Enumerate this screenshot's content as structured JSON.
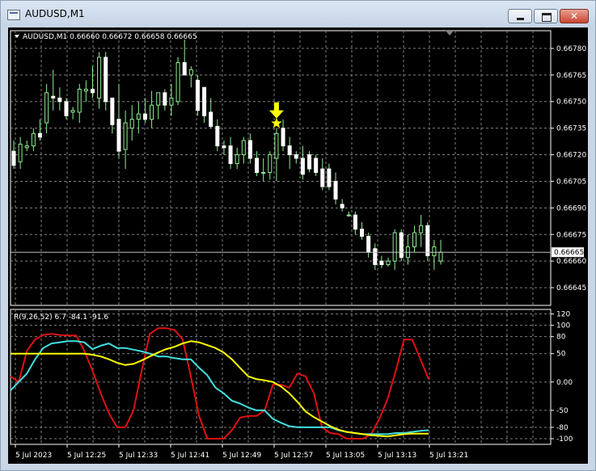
{
  "window": {
    "title": "AUDUSD,M1",
    "min_glyph": "",
    "max_glyph": "",
    "close_glyph": "✕"
  },
  "main_panel": {
    "info": "AUDUSD,M1  0.66660 0.66672 0.66658 0.66665",
    "current_price": "0.66665",
    "price_labels": [
      "0.66780",
      "0.66765",
      "0.66750",
      "0.66735",
      "0.66720",
      "0.66705",
      "0.66690",
      "0.66675",
      "0.66660",
      "0.66645"
    ]
  },
  "indicator_panel": {
    "info": "R(9,26,52) 6.7 -84.1 -91.6",
    "levels": [
      "120",
      "100",
      "80",
      "50",
      "0.00",
      "-50",
      "-80",
      "-100"
    ]
  },
  "time_labels": [
    "5 Jul 2023",
    "5 Jul 12:25",
    "5 Jul 12:33",
    "5 Jul 12:41",
    "5 Jul 12:49",
    "5 Jul 12:57",
    "5 Jul 13:05",
    "5 Jul 13:13",
    "5 Jul 13:21"
  ],
  "colors": {
    "background": "#000000",
    "grid": "#808080",
    "candle": "#90ee90",
    "arrow": "#ffff00",
    "line_fast": "#e01010",
    "line_mid": "#40e0e0",
    "line_slow": "#ffff00"
  },
  "chart_data": [
    {
      "type": "candlestick",
      "symbol": "AUDUSD",
      "timeframe": "M1",
      "ylim": [
        0.66635,
        0.6679
      ],
      "y_ticks": [
        0.6678,
        0.66765,
        0.6675,
        0.66735,
        0.6672,
        0.66705,
        0.6669,
        0.66675,
        0.6666,
        0.66645
      ],
      "current_price": 0.66665,
      "signal_marker": {
        "candle_index": 40,
        "type": "down-arrow-star"
      },
      "candles": [
        {
          "o": 0.66722,
          "h": 0.66728,
          "l": 0.66712,
          "c": 0.66714
        },
        {
          "o": 0.66716,
          "h": 0.6673,
          "l": 0.66712,
          "c": 0.66726
        },
        {
          "o": 0.66724,
          "h": 0.66728,
          "l": 0.66722,
          "c": 0.66725
        },
        {
          "o": 0.66725,
          "h": 0.66735,
          "l": 0.66722,
          "c": 0.66732
        },
        {
          "o": 0.66732,
          "h": 0.6674,
          "l": 0.66728,
          "c": 0.6673
        },
        {
          "o": 0.66738,
          "h": 0.6676,
          "l": 0.66732,
          "c": 0.66755
        },
        {
          "o": 0.66753,
          "h": 0.66768,
          "l": 0.66745,
          "c": 0.66752
        },
        {
          "o": 0.66752,
          "h": 0.66758,
          "l": 0.66745,
          "c": 0.6675
        },
        {
          "o": 0.6675,
          "h": 0.66752,
          "l": 0.6674,
          "c": 0.66742
        },
        {
          "o": 0.66744,
          "h": 0.66747,
          "l": 0.6674,
          "c": 0.66745
        },
        {
          "o": 0.66744,
          "h": 0.6676,
          "l": 0.66738,
          "c": 0.66757
        },
        {
          "o": 0.66756,
          "h": 0.66762,
          "l": 0.6675,
          "c": 0.66757
        },
        {
          "o": 0.66757,
          "h": 0.6677,
          "l": 0.66752,
          "c": 0.66755
        },
        {
          "o": 0.66752,
          "h": 0.66778,
          "l": 0.66746,
          "c": 0.66775
        },
        {
          "o": 0.66775,
          "h": 0.66778,
          "l": 0.66745,
          "c": 0.6675
        },
        {
          "o": 0.66752,
          "h": 0.66752,
          "l": 0.66732,
          "c": 0.66737
        },
        {
          "o": 0.6674,
          "h": 0.6676,
          "l": 0.66718,
          "c": 0.66722
        },
        {
          "o": 0.66723,
          "h": 0.66745,
          "l": 0.66712,
          "c": 0.66738
        },
        {
          "o": 0.66735,
          "h": 0.66748,
          "l": 0.66728,
          "c": 0.6674
        },
        {
          "o": 0.6674,
          "h": 0.6675,
          "l": 0.66732,
          "c": 0.66743
        },
        {
          "o": 0.66743,
          "h": 0.66752,
          "l": 0.66738,
          "c": 0.6674
        },
        {
          "o": 0.6674,
          "h": 0.66756,
          "l": 0.66735,
          "c": 0.66748
        },
        {
          "o": 0.66748,
          "h": 0.66755,
          "l": 0.6674,
          "c": 0.66755
        },
        {
          "o": 0.66755,
          "h": 0.66757,
          "l": 0.66745,
          "c": 0.66748
        },
        {
          "o": 0.66748,
          "h": 0.6676,
          "l": 0.66742,
          "c": 0.66752
        },
        {
          "o": 0.6675,
          "h": 0.66775,
          "l": 0.66748,
          "c": 0.66772
        },
        {
          "o": 0.66772,
          "h": 0.66785,
          "l": 0.66765,
          "c": 0.66765
        },
        {
          "o": 0.66765,
          "h": 0.6677,
          "l": 0.66758,
          "c": 0.66768
        },
        {
          "o": 0.66762,
          "h": 0.66765,
          "l": 0.66742,
          "c": 0.66745
        },
        {
          "o": 0.66758,
          "h": 0.66758,
          "l": 0.66738,
          "c": 0.66742
        },
        {
          "o": 0.66744,
          "h": 0.66752,
          "l": 0.66735,
          "c": 0.66736
        },
        {
          "o": 0.66736,
          "h": 0.6674,
          "l": 0.66722,
          "c": 0.66725
        },
        {
          "o": 0.66725,
          "h": 0.66728,
          "l": 0.6672,
          "c": 0.66724
        },
        {
          "o": 0.66725,
          "h": 0.6673,
          "l": 0.66712,
          "c": 0.66715
        },
        {
          "o": 0.66715,
          "h": 0.66724,
          "l": 0.66712,
          "c": 0.6672
        },
        {
          "o": 0.6672,
          "h": 0.6673,
          "l": 0.66715,
          "c": 0.66728
        },
        {
          "o": 0.66728,
          "h": 0.66732,
          "l": 0.66715,
          "c": 0.66718
        },
        {
          "o": 0.66718,
          "h": 0.66722,
          "l": 0.66708,
          "c": 0.6671
        },
        {
          "o": 0.6671,
          "h": 0.66718,
          "l": 0.66705,
          "c": 0.6671
        },
        {
          "o": 0.6671,
          "h": 0.66722,
          "l": 0.66706,
          "c": 0.6672
        },
        {
          "o": 0.66718,
          "h": 0.66735,
          "l": 0.66705,
          "c": 0.66732
        },
        {
          "o": 0.66735,
          "h": 0.6674,
          "l": 0.66722,
          "c": 0.66725
        },
        {
          "o": 0.66725,
          "h": 0.6673,
          "l": 0.66712,
          "c": 0.6672
        },
        {
          "o": 0.6672,
          "h": 0.66722,
          "l": 0.66715,
          "c": 0.66718
        },
        {
          "o": 0.66718,
          "h": 0.66725,
          "l": 0.66706,
          "c": 0.66709
        },
        {
          "o": 0.6672,
          "h": 0.66722,
          "l": 0.6671,
          "c": 0.66712
        },
        {
          "o": 0.66718,
          "h": 0.6672,
          "l": 0.66708,
          "c": 0.6671
        },
        {
          "o": 0.66712,
          "h": 0.66718,
          "l": 0.667,
          "c": 0.66702
        },
        {
          "o": 0.66712,
          "h": 0.66715,
          "l": 0.667,
          "c": 0.66702
        },
        {
          "o": 0.66705,
          "h": 0.6671,
          "l": 0.66692,
          "c": 0.66695
        },
        {
          "o": 0.66692,
          "h": 0.66695,
          "l": 0.66688,
          "c": 0.6669
        },
        {
          "o": 0.66686,
          "h": 0.66688,
          "l": 0.66685,
          "c": 0.66686
        },
        {
          "o": 0.66686,
          "h": 0.66688,
          "l": 0.66675,
          "c": 0.66678
        },
        {
          "o": 0.66678,
          "h": 0.66682,
          "l": 0.66672,
          "c": 0.66674
        },
        {
          "o": 0.66674,
          "h": 0.66676,
          "l": 0.66662,
          "c": 0.66665
        },
        {
          "o": 0.66667,
          "h": 0.6667,
          "l": 0.66655,
          "c": 0.66658
        },
        {
          "o": 0.6666,
          "h": 0.66663,
          "l": 0.66656,
          "c": 0.66658
        },
        {
          "o": 0.66658,
          "h": 0.66662,
          "l": 0.66657,
          "c": 0.6666
        },
        {
          "o": 0.6666,
          "h": 0.66678,
          "l": 0.66655,
          "c": 0.66676
        },
        {
          "o": 0.66676,
          "h": 0.66678,
          "l": 0.6666,
          "c": 0.66662
        },
        {
          "o": 0.66662,
          "h": 0.66675,
          "l": 0.66658,
          "c": 0.66668
        },
        {
          "o": 0.66668,
          "h": 0.6668,
          "l": 0.66665,
          "c": 0.66676
        },
        {
          "o": 0.66676,
          "h": 0.66686,
          "l": 0.66668,
          "c": 0.6668
        },
        {
          "o": 0.6668,
          "h": 0.66682,
          "l": 0.6666,
          "c": 0.66663
        },
        {
          "o": 0.66663,
          "h": 0.66672,
          "l": 0.66655,
          "c": 0.66668
        },
        {
          "o": 0.6666,
          "h": 0.66672,
          "l": 0.66658,
          "c": 0.66665
        }
      ]
    },
    {
      "type": "line",
      "title": "R(9,26,52)",
      "ylim": [
        -110,
        128
      ],
      "y_ticks": [
        120,
        100,
        80,
        50,
        0,
        -50,
        -80,
        -100
      ],
      "series": [
        {
          "name": "",
          "color": "#e01010",
          "values": [
            10,
            0,
            55,
            75,
            83,
            85,
            83,
            82,
            82,
            55,
            20,
            -20,
            -55,
            -80,
            -80,
            -50,
            20,
            85,
            95,
            95,
            92,
            75,
            10,
            -60,
            -100,
            -100,
            -100,
            -85,
            -63,
            -60,
            -60,
            -50,
            -5,
            -5,
            -10,
            15,
            10,
            -20,
            -80,
            -90,
            -92,
            -100,
            -100,
            -100,
            -92,
            -65,
            -30,
            20,
            75,
            75,
            40,
            5
          ]
        },
        {
          "name": "",
          "color": "#40e0e0",
          "values": [
            -15,
            0,
            15,
            40,
            60,
            68,
            70,
            72,
            72,
            70,
            58,
            64,
            68,
            60,
            60,
            57,
            54,
            50,
            45,
            45,
            42,
            40,
            40,
            25,
            12,
            -10,
            -20,
            -33,
            -38,
            -45,
            -50,
            -50,
            -65,
            -72,
            -78,
            -80,
            -80,
            -80,
            -80,
            -80,
            -85,
            -88,
            -90,
            -92,
            -92,
            -92,
            -92,
            -90,
            -90,
            -88,
            -86,
            -85
          ]
        },
        {
          "name": "",
          "color": "#ffff00",
          "values": [
            50,
            50,
            50,
            50,
            50,
            50,
            50,
            50,
            50,
            50,
            48,
            45,
            40,
            34,
            30,
            32,
            38,
            45,
            52,
            58,
            62,
            68,
            72,
            70,
            65,
            60,
            52,
            40,
            25,
            10,
            5,
            3,
            0,
            -8,
            -20,
            -35,
            -52,
            -62,
            -70,
            -78,
            -84,
            -88,
            -90,
            -92,
            -94,
            -95,
            -96,
            -94,
            -92,
            -91,
            -91,
            -91
          ]
        }
      ]
    }
  ]
}
